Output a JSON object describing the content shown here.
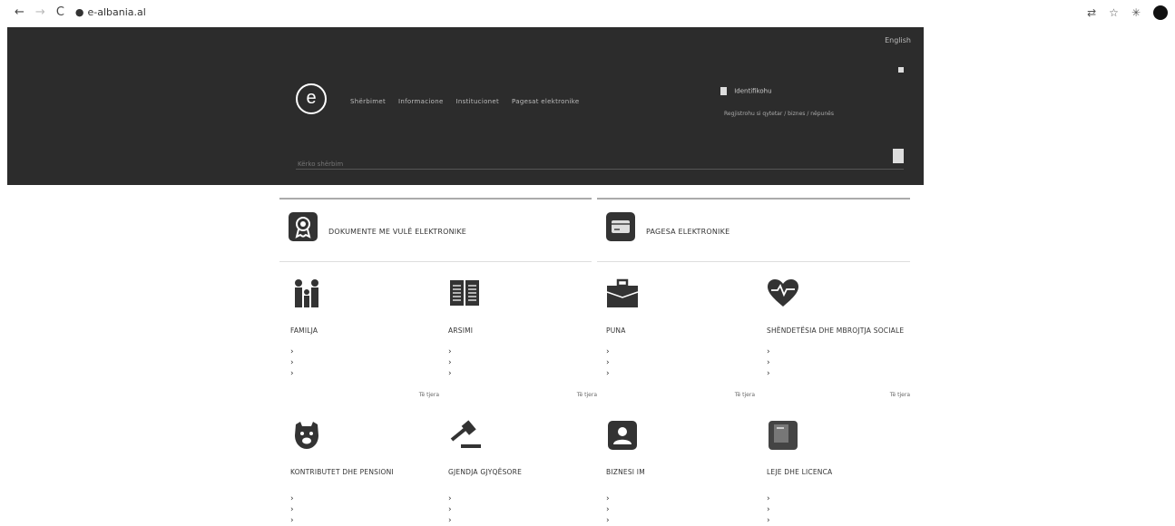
{
  "browser": {
    "back": "←",
    "forward": "→",
    "reload": "C",
    "url": "e-albania.al"
  },
  "header": {
    "lang": "English",
    "logo_letter": "e",
    "nav": [
      "Shërbimet",
      "Informacione",
      "Institucionet",
      "Pagesat elektronike"
    ],
    "login": "Identifikohu",
    "register": "Regjistrohu si qytetar / biznes / nëpunës",
    "search_placeholder": "Kërko shërbim"
  },
  "services": [
    {
      "label": "DOKUMENTE ME VULË ELEKTRONIKE",
      "icon": "seal-icon"
    },
    {
      "label": "PAGESA ELEKTRONIKE",
      "icon": "card-payment-icon"
    }
  ],
  "categories": [
    {
      "title": "FAMILJA",
      "icon": "family-icon",
      "links": [
        "›",
        "›",
        "›"
      ],
      "more": "Të tjera"
    },
    {
      "title": "ARSIMI",
      "icon": "book-icon",
      "links": [
        "›",
        "›",
        "›"
      ],
      "more": "Të tjera"
    },
    {
      "title": "PUNA",
      "icon": "briefcase-icon",
      "links": [
        "›",
        "›",
        "›"
      ],
      "more": "Të tjera"
    },
    {
      "title": "SHËNDETËSIA DHE MBROJTJA SOCIALE",
      "icon": "heart-icon",
      "links": [
        "›",
        "›",
        "›"
      ],
      "more": "Të tjera"
    },
    {
      "title": "KONTRIBUTET DHE PENSIONI",
      "icon": "piggy-bank-icon",
      "links": [
        "›",
        "›",
        "›"
      ],
      "more": ""
    },
    {
      "title": "GJENDJA GJYQËSORE",
      "icon": "gavel-icon",
      "links": [
        "›",
        "›",
        "›"
      ],
      "more": ""
    },
    {
      "title": "BIZNESI IM",
      "icon": "business-person-icon",
      "links": [
        "›",
        "›",
        "›"
      ],
      "more": ""
    },
    {
      "title": "LEJE DHE LICENCA",
      "icon": "license-icon",
      "links": [
        "›",
        "›",
        "›"
      ],
      "more": ""
    }
  ],
  "colors": {
    "header_bg": "#2c2c2c",
    "accent": "#e8453c"
  }
}
